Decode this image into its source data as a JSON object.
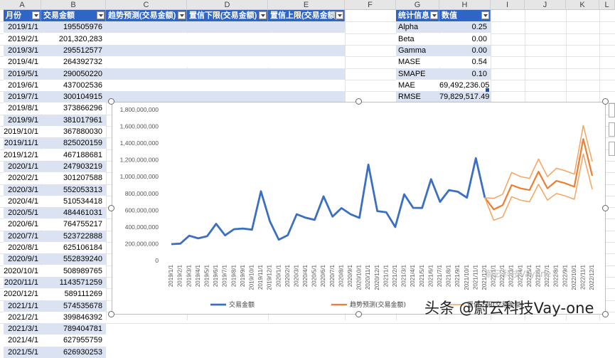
{
  "columns": [
    "A",
    "B",
    "C",
    "D",
    "E",
    "F",
    "G",
    "H",
    "I",
    "J",
    "K",
    "L"
  ],
  "table": {
    "headers": [
      "月份",
      "交易金额",
      "趋势预测(交易金额)",
      "置信下限(交易金额)",
      "置信上限(交易金额)"
    ],
    "rows": [
      {
        "date": "2019/1/1",
        "value": "195505976"
      },
      {
        "date": "2019/2/1",
        "value": "201,320,283"
      },
      {
        "date": "2019/3/1",
        "value": "295512577"
      },
      {
        "date": "2019/4/1",
        "value": "264392732"
      },
      {
        "date": "2019/5/1",
        "value": "290050220"
      },
      {
        "date": "2019/6/1",
        "value": "437002536"
      },
      {
        "date": "2019/7/1",
        "value": "300104915"
      },
      {
        "date": "2019/8/1",
        "value": "373866296"
      },
      {
        "date": "2019/9/1",
        "value": "381017961"
      },
      {
        "date": "2019/10/1",
        "value": "367880030"
      },
      {
        "date": "2019/11/1",
        "value": "825020159"
      },
      {
        "date": "2019/12/1",
        "value": "467188681"
      },
      {
        "date": "2020/1/1",
        "value": "247903219"
      },
      {
        "date": "2020/2/1",
        "value": "301207588"
      },
      {
        "date": "2020/3/1",
        "value": "552053313"
      },
      {
        "date": "2020/4/1",
        "value": "510534418"
      },
      {
        "date": "2020/5/1",
        "value": "484461031"
      },
      {
        "date": "2020/6/1",
        "value": "764755217"
      },
      {
        "date": "2020/7/1",
        "value": "523722888"
      },
      {
        "date": "2020/8/1",
        "value": "625106184"
      },
      {
        "date": "2020/9/1",
        "value": "552839240"
      },
      {
        "date": "2020/10/1",
        "value": "508989765"
      },
      {
        "date": "2020/11/1",
        "value": "1143571259"
      },
      {
        "date": "2020/12/1",
        "value": "589111269"
      },
      {
        "date": "2021/1/1",
        "value": "574535678"
      },
      {
        "date": "2021/2/1",
        "value": "399846392"
      },
      {
        "date": "2021/3/1",
        "value": "789404781"
      },
      {
        "date": "2021/4/1",
        "value": "627955759"
      },
      {
        "date": "2021/5/1",
        "value": "626930253"
      }
    ]
  },
  "stats": {
    "headers": [
      "统计信息",
      "数值"
    ],
    "rows": [
      {
        "name": "Alpha",
        "value": "0.25"
      },
      {
        "name": "Beta",
        "value": "0.00"
      },
      {
        "name": "Gamma",
        "value": "0.00"
      },
      {
        "name": "MASE",
        "value": "0.54"
      },
      {
        "name": "SMAPE",
        "value": "0.10"
      },
      {
        "name": "MAE",
        "value": "69,492,236.05"
      },
      {
        "name": "RMSE",
        "value": "79,829,517.49"
      }
    ]
  },
  "watermark": "头条 @蔚云科技Vay-one",
  "watermark_faint": "蔚云科技Vayone",
  "colors": {
    "header": "#2f66c5",
    "band": "#dbe3f3",
    "actual": "#3a6fc4",
    "forecast": "#ed7d31",
    "bounds": "#f4a460"
  },
  "chart_data": {
    "type": "line",
    "x": [
      "2019/1/1",
      "2019/2/1",
      "2019/3/1",
      "2019/4/1",
      "2019/5/1",
      "2019/6/1",
      "2019/7/1",
      "2019/8/1",
      "2019/9/1",
      "2019/10/1",
      "2019/11/1",
      "2019/12/1",
      "2020/1/1",
      "2020/2/1",
      "2020/3/1",
      "2020/4/1",
      "2020/5/1",
      "2020/6/1",
      "2020/7/1",
      "2020/8/1",
      "2020/9/1",
      "2020/10/1",
      "2020/11/1",
      "2020/12/1",
      "2021/1/1",
      "2021/2/1",
      "2021/3/1",
      "2021/4/1",
      "2021/5/1",
      "2021/6/1",
      "2021/7/1",
      "2021/8/1",
      "2021/9/1",
      "2021/10/1",
      "2021/11/1",
      "2021/12/1",
      "2022/1/1",
      "2022/2/1",
      "2022/3/1",
      "2022/4/1",
      "2022/5/1",
      "2022/6/1",
      "2022/7/1",
      "2022/8/1",
      "2022/9/1",
      "2022/10/1",
      "2022/11/1",
      "2022/12/1"
    ],
    "yticks": [
      "0",
      "200,000,000",
      "400,000,000",
      "600,000,000",
      "800,000,000",
      "1,000,000,000",
      "1,200,000,000",
      "1,400,000,000",
      "1,600,000,000",
      "1,800,000,000"
    ],
    "ylim": [
      0,
      1800000000
    ],
    "series": [
      {
        "name": "交易金额",
        "color": "#3a6fc4",
        "start": 0,
        "values": [
          195505976,
          201320283,
          295512577,
          264392732,
          290050220,
          437002536,
          300104915,
          373866296,
          381017961,
          367880030,
          825020159,
          467188681,
          247903219,
          301207588,
          552053313,
          510534418,
          484461031,
          764755217,
          523722888,
          625106184,
          552839240,
          508989765,
          1143571259,
          589111269,
          574535678,
          399846392,
          789404781,
          627955759,
          626930253,
          970000000,
          700000000,
          840000000,
          820000000,
          750000000,
          1220000000,
          750000000
        ]
      },
      {
        "name": "趋势预测(交易金额)",
        "color": "#ed7d31",
        "start": 35,
        "values": [
          750000000,
          610000000,
          660000000,
          900000000,
          860000000,
          840000000,
          1060000000,
          860000000,
          950000000,
          920000000,
          880000000,
          1450000000,
          1010000000
        ]
      },
      {
        "name": "置信下限(交易金额)",
        "color": "#f4a460",
        "start": 35,
        "values": [
          750000000,
          480000000,
          520000000,
          760000000,
          720000000,
          700000000,
          910000000,
          720000000,
          800000000,
          770000000,
          730000000,
          1270000000,
          850000000
        ]
      },
      {
        "name": "置信上限(交易金额)",
        "color": "#f4a460",
        "start": 35,
        "values": [
          750000000,
          740000000,
          790000000,
          1050000000,
          1000000000,
          980000000,
          1210000000,
          1000000000,
          1100000000,
          1070000000,
          1030000000,
          1610000000,
          1180000000
        ]
      }
    ],
    "legend": [
      "交易金额",
      "趋势预测(交易金额)",
      "置信下限(交易金额)"
    ],
    "legend_position": "bottom",
    "grid": false
  }
}
